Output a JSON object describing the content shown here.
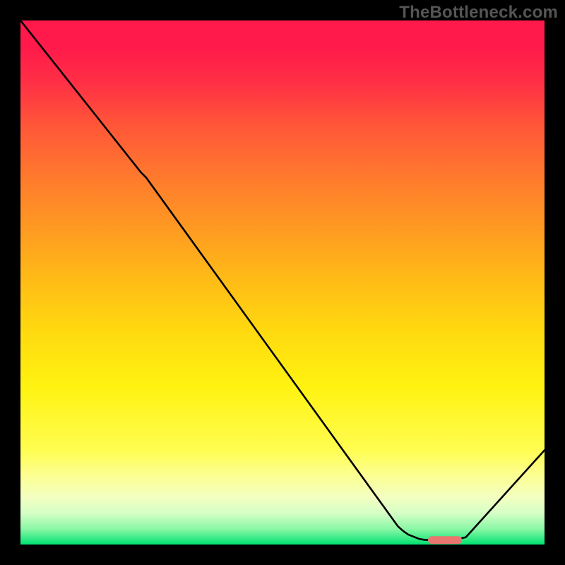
{
  "watermark": "TheBottleneck.com",
  "chart_data": {
    "type": "line",
    "title": "",
    "xlabel": "",
    "ylabel": "",
    "xlim": [
      0,
      100
    ],
    "ylim": [
      0,
      100
    ],
    "grid": false,
    "series": [
      {
        "name": "curve",
        "x": [
          0,
          23,
          24,
          72,
          73,
          74,
          76,
          77,
          79,
          80,
          81,
          82,
          83,
          85,
          100
        ],
        "y": [
          100,
          71,
          70,
          3.5,
          2.6,
          1.9,
          1.1,
          0.9,
          0.8,
          0.8,
          0.8,
          0.8,
          0.9,
          1.4,
          18
        ]
      },
      {
        "name": "marker",
        "x": [
          78.5,
          83.5
        ],
        "y": [
          0.85,
          0.85
        ]
      }
    ],
    "background_gradient": {
      "stops": [
        {
          "pos": 0.0,
          "color": "#ff1a4b"
        },
        {
          "pos": 0.05,
          "color": "#ff1a4b"
        },
        {
          "pos": 0.12,
          "color": "#ff3045"
        },
        {
          "pos": 0.2,
          "color": "#ff5638"
        },
        {
          "pos": 0.3,
          "color": "#ff7a2d"
        },
        {
          "pos": 0.4,
          "color": "#ff9b21"
        },
        {
          "pos": 0.5,
          "color": "#ffbd16"
        },
        {
          "pos": 0.6,
          "color": "#ffdb0f"
        },
        {
          "pos": 0.7,
          "color": "#fff311"
        },
        {
          "pos": 0.82,
          "color": "#fffd51"
        },
        {
          "pos": 0.87,
          "color": "#fcff94"
        },
        {
          "pos": 0.91,
          "color": "#f2ffc0"
        },
        {
          "pos": 0.94,
          "color": "#d6ffc6"
        },
        {
          "pos": 0.97,
          "color": "#8bf7a6"
        },
        {
          "pos": 1.0,
          "color": "#00e371"
        }
      ]
    },
    "marker_color": "#e9766f"
  }
}
